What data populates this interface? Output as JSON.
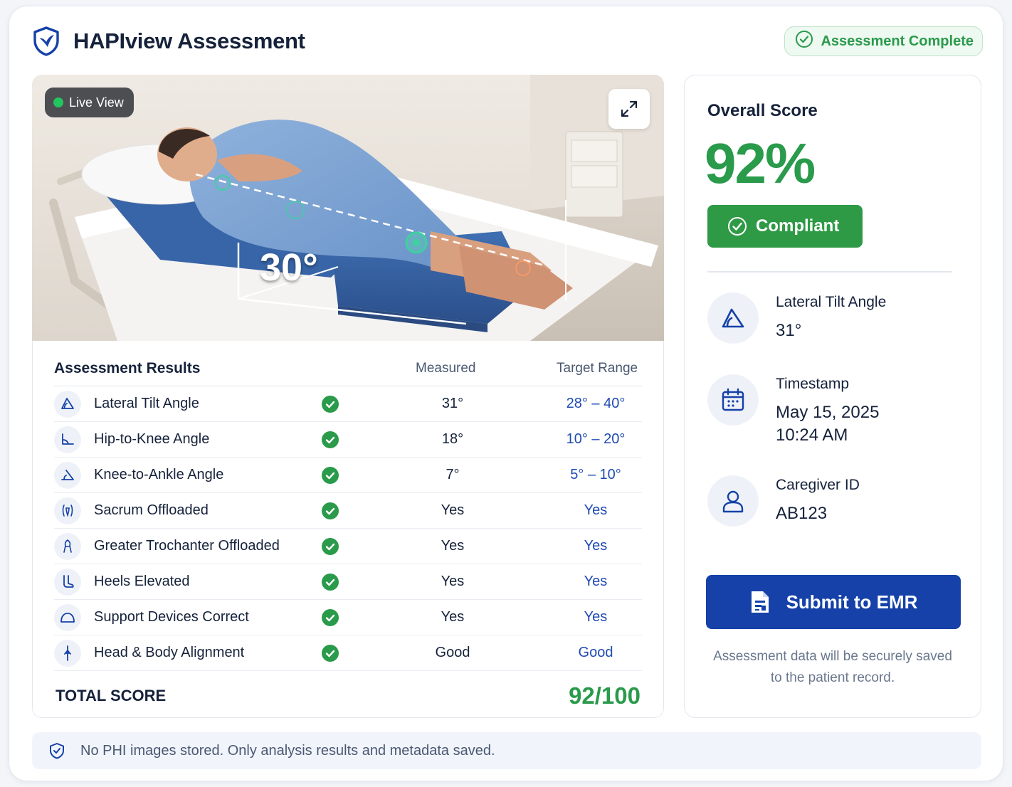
{
  "header": {
    "title": "HAPIview Assessment",
    "status_badge": "Assessment Complete"
  },
  "live_view": {
    "label": "Live View",
    "angle_overlay": "30°"
  },
  "results": {
    "title": "Assessment Results",
    "col_measured": "Measured",
    "col_target": "Target Range",
    "rows": [
      {
        "icon": "angle-icon",
        "label": "Lateral Tilt Angle",
        "measured": "31°",
        "target": "28° – 40°"
      },
      {
        "icon": "hip-knee-icon",
        "label": "Hip-to-Knee Angle",
        "measured": "18°",
        "target": "10° – 20°"
      },
      {
        "icon": "knee-ankle-icon",
        "label": "Knee-to-Ankle Angle",
        "measured": "7°",
        "target": "5° – 10°"
      },
      {
        "icon": "sacrum-icon",
        "label": "Sacrum Offloaded",
        "measured": "Yes",
        "target": "Yes"
      },
      {
        "icon": "trochanter-icon",
        "label": "Greater Trochanter Offloaded",
        "measured": "Yes",
        "target": "Yes"
      },
      {
        "icon": "heel-icon",
        "label": "Heels Elevated",
        "measured": "Yes",
        "target": "Yes"
      },
      {
        "icon": "support-device-icon",
        "label": "Support Devices Correct",
        "measured": "Yes",
        "target": "Yes"
      },
      {
        "icon": "alignment-icon",
        "label": "Head & Body Alignment",
        "measured": "Good",
        "target": "Good"
      }
    ],
    "total_label": "TOTAL SCORE",
    "total_value": "92/100"
  },
  "summary": {
    "title": "Overall Score",
    "score": "92%",
    "compliance": "Compliant",
    "tilt_label": "Lateral Tilt Angle",
    "tilt_value": "31°",
    "timestamp_label": "Timestamp",
    "timestamp_date": "May 15, 2025",
    "timestamp_time": "10:24 AM",
    "caregiver_label": "Caregiver ID",
    "caregiver_value": "AB123",
    "submit_label": "Submit to EMR",
    "note": "Assessment data will be securely saved to the patient record."
  },
  "footer": {
    "privacy_note": "No PHI images stored. Only analysis results and metadata saved."
  },
  "colors": {
    "brand_blue": "#1541a8",
    "success_green": "#2a9a4b",
    "target_blue": "#1f4ab3",
    "text_dark": "#16223b"
  }
}
